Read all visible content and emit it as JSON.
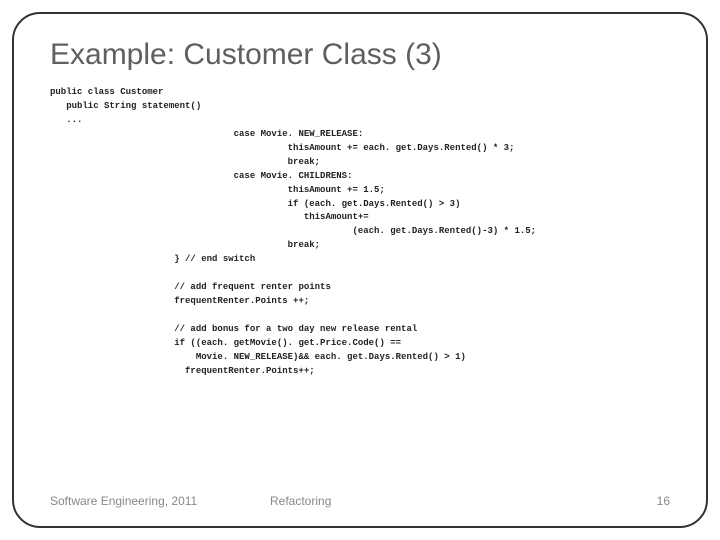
{
  "title": "Example: Customer Class (3)",
  "code": {
    "l01": "public class Customer",
    "l02": "   public String statement()",
    "l03": "   ...",
    "l04": "                                  case Movie. NEW_RELEASE:",
    "l05": "                                            thisAmount += each. get.Days.Rented() * 3;",
    "l06": "                                            break;",
    "l07": "                                  case Movie. CHILDRENS:",
    "l08": "                                            thisAmount += 1.5;",
    "l09": "                                            if (each. get.Days.Rented() > 3)",
    "l10": "                                               thisAmount+=",
    "l11": "                                                        (each. get.Days.Rented()-3) * 1.5;",
    "l12": "                                            break;",
    "l13": "                       } // end switch",
    "l14": "",
    "l15": "                       // add frequent renter points",
    "l16": "                       frequentRenter.Points ++;",
    "l17": "",
    "l18": "                       // add bonus for a two day new release rental",
    "l19": "                       if ((each. getMovie(). get.Price.Code() ==",
    "l20": "                           Movie. NEW_RELEASE)&& each. get.Days.Rented() > 1)",
    "l21": "                         frequentRenter.Points++;"
  },
  "footer": {
    "left": "Software Engineering, 2011",
    "center": "Refactoring",
    "right": "16"
  }
}
